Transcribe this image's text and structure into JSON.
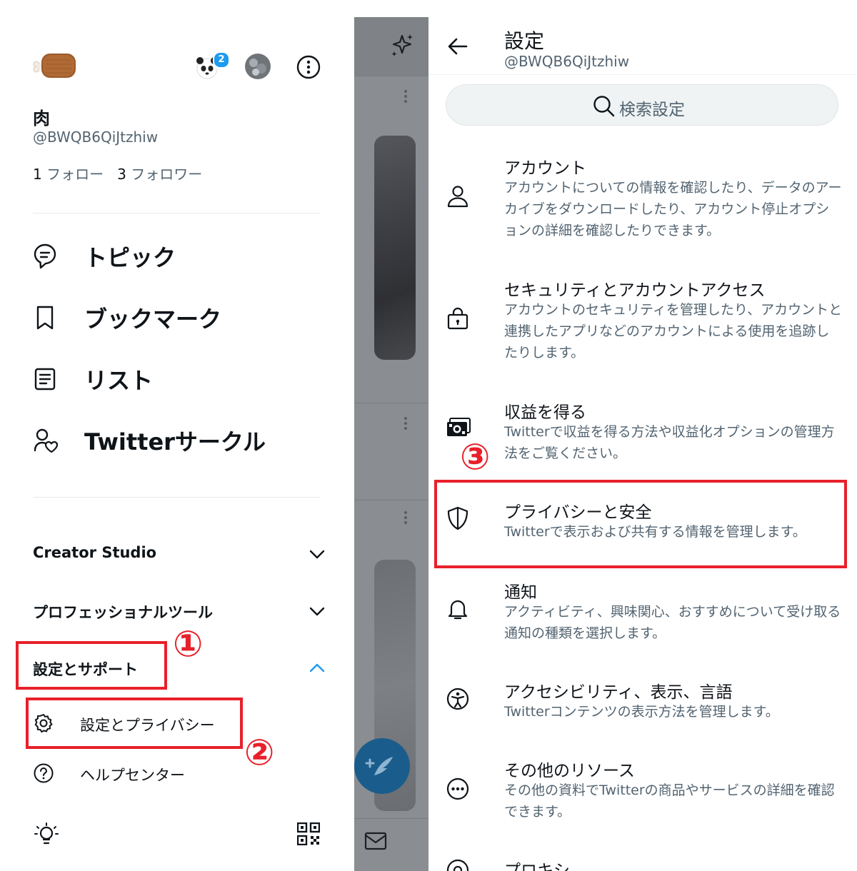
{
  "drawer": {
    "account": {
      "name": "肉",
      "handle": "@BWQB6QiJtzhiw",
      "following_count": "1",
      "following_label": "フォロー",
      "followers_count": "3",
      "followers_label": "フォロワー",
      "notification_badge": "2"
    },
    "nav": [
      {
        "label": "トピック",
        "icon": "topic-icon"
      },
      {
        "label": "ブックマーク",
        "icon": "bookmark-icon"
      },
      {
        "label": "リスト",
        "icon": "list-icon"
      },
      {
        "label": "Twitterサークル",
        "icon": "circle-icon"
      }
    ],
    "sections": {
      "creator_studio": "Creator Studio",
      "professional_tools": "プロフェッショナルツール",
      "settings_support": "設定とサポート"
    },
    "sub_items": {
      "settings_privacy": "設定とプライバシー",
      "help_center": "ヘルプセンター"
    }
  },
  "settings": {
    "title": "設定",
    "handle": "@BWQB6QiJtzhiw",
    "search_label": "検索設定",
    "items": [
      {
        "title": "アカウント",
        "desc": "アカウントについての情報を確認したり、データのアーカイブをダウンロードしたり、アカウント停止オプションの詳細を確認したりできます。",
        "icon": "person-icon"
      },
      {
        "title": "セキュリティとアカウントアクセス",
        "desc": "アカウントのセキュリティを管理したり、アカウントと連携したアプリなどのアカウントによる使用を追跡したりします。",
        "icon": "lock-icon"
      },
      {
        "title": "収益を得る",
        "desc": "Twitterで収益を得る方法や収益化オプションの管理方法をご覧ください。",
        "icon": "money-icon"
      },
      {
        "title": "プライバシーと安全",
        "desc": "Twitterで表示および共有する情報を管理します。",
        "icon": "shield-icon"
      },
      {
        "title": "通知",
        "desc": "アクティビティ、興味関心、おすすめについて受け取る通知の種類を選択します。",
        "icon": "bell-icon"
      },
      {
        "title": "アクセシビリティ、表示、言語",
        "desc": "Twitterコンテンツの表示方法を管理します。",
        "icon": "accessibility-icon"
      },
      {
        "title": "その他のリソース",
        "desc": "その他の資料でTwitterの商品やサービスの詳細を確認できます。",
        "icon": "more-icon"
      },
      {
        "title": "プロキシ",
        "desc": "",
        "icon": "proxy-icon"
      }
    ]
  },
  "annotations": {
    "step1": "①",
    "step2": "②",
    "step3": "③",
    "color": "#e8202a"
  },
  "colors": {
    "accent": "#1d9bf0",
    "text_primary": "#0f1419",
    "text_secondary": "#536471",
    "annotation_red": "#e8202a"
  }
}
